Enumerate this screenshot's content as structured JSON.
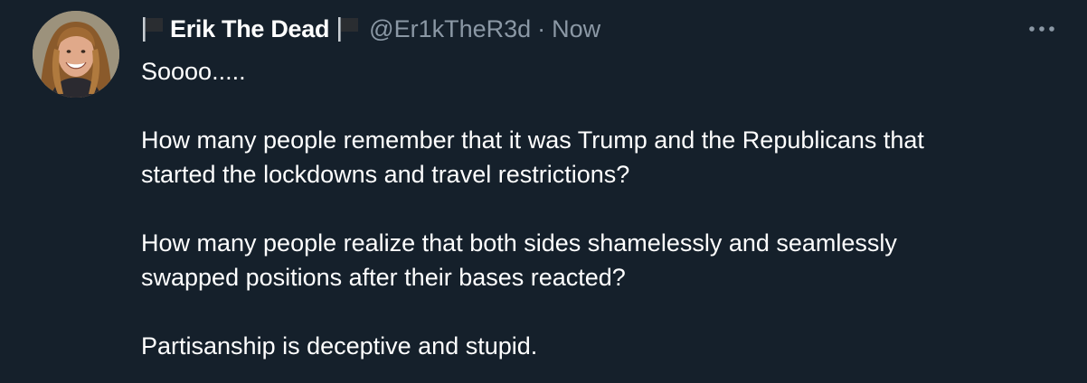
{
  "tweet": {
    "display_name": "Erik The Dead",
    "handle": "@Er1kTheR3d",
    "separator": "·",
    "timestamp": "Now",
    "more_icon": "more-horizontal-icon",
    "flag_icon": "black-flag-icon",
    "body": {
      "line1": "Soooo.....",
      "para2_line1": "How many people remember that it was Trump and the Republicans that",
      "para2_line2": "started the lockdowns and travel restrictions?",
      "para3_line1": "How many people realize that both sides shamelessly and seamlessly",
      "para3_line2": "swapped positions after their bases reacted?",
      "para4_line1": "Partisanship is deceptive and stupid."
    }
  },
  "colors": {
    "background": "#15202b",
    "text_primary": "#ffffff",
    "text_secondary": "#8b98a5"
  }
}
